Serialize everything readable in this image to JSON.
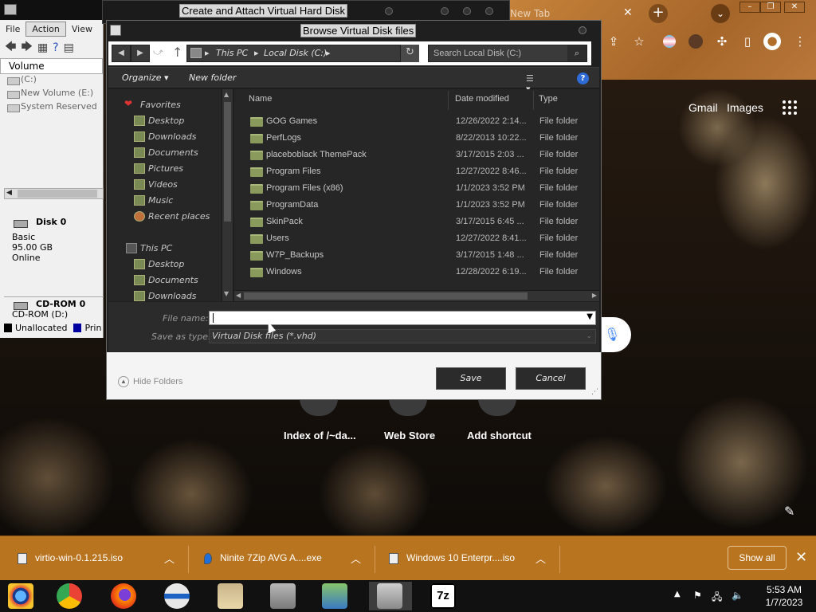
{
  "browser": {
    "tab_title": "New Tab",
    "links": {
      "gmail": "Gmail",
      "images": "Images"
    },
    "shortcuts": [
      "Index of /~da...",
      "Web Store",
      "Add shortcut"
    ]
  },
  "disk_mgmt": {
    "menu": [
      "File",
      "Action",
      "View"
    ],
    "column_header": "Volume",
    "volumes": [
      "(C:)",
      "New Volume (E:)",
      "System Reserved"
    ],
    "disk0": {
      "name": "Disk 0",
      "type": "Basic",
      "size": "95.00 GB",
      "status": "Online"
    },
    "cdrom": {
      "name": "CD-ROM 0",
      "drive": "CD-ROM (D:)"
    },
    "legend": {
      "unallocated": "Unallocated",
      "primary": "Prin"
    }
  },
  "vhd_window": {
    "title": "Create and Attach Virtual Hard Disk"
  },
  "dialog": {
    "title": "Browse Virtual Disk files",
    "breadcrumb": [
      "This PC",
      "Local Disk (C:)"
    ],
    "search_placeholder": "Search Local Disk (C:)",
    "toolbar": {
      "organize": "Organize",
      "new_folder": "New folder"
    },
    "nav": {
      "favorites": "Favorites",
      "favorite_items": [
        "Desktop",
        "Downloads",
        "Documents",
        "Pictures",
        "Videos",
        "Music",
        "Recent places"
      ],
      "this_pc": "This PC",
      "pc_items": [
        "Desktop",
        "Documents",
        "Downloads"
      ]
    },
    "columns": {
      "name": "Name",
      "date": "Date modified",
      "type": "Type"
    },
    "files": [
      {
        "name": "GOG Games",
        "date": "12/26/2022 2:14...",
        "type": "File folder"
      },
      {
        "name": "PerfLogs",
        "date": "8/22/2013 10:22...",
        "type": "File folder"
      },
      {
        "name": "placeboblack ThemePack",
        "date": "3/17/2015 2:03 ...",
        "type": "File folder"
      },
      {
        "name": "Program Files",
        "date": "12/27/2022 8:46...",
        "type": "File folder"
      },
      {
        "name": "Program Files (x86)",
        "date": "1/1/2023 3:52 PM",
        "type": "File folder"
      },
      {
        "name": "ProgramData",
        "date": "1/1/2023 3:52 PM",
        "type": "File folder"
      },
      {
        "name": "SkinPack",
        "date": "3/17/2015 6:45 ...",
        "type": "File folder"
      },
      {
        "name": "Users",
        "date": "12/27/2022 8:41...",
        "type": "File folder"
      },
      {
        "name": "W7P_Backups",
        "date": "3/17/2015 1:48 ...",
        "type": "File folder"
      },
      {
        "name": "Windows",
        "date": "12/28/2022 6:19...",
        "type": "File folder"
      }
    ],
    "file_name_label": "File name:",
    "file_name_value": "",
    "save_as_label": "Save as type:",
    "save_as_value": "Virtual Disk files (*.vhd)",
    "hide_folders": "Hide Folders",
    "save_button": "Save",
    "cancel_button": "Cancel"
  },
  "downloads": {
    "items": [
      "virtio-win-0.1.215.iso",
      "Ninite 7Zip AVG A....exe",
      "Windows 10 Enterpr....iso"
    ],
    "show_all": "Show all"
  },
  "taskbar": {
    "time": "5:53 AM",
    "date": "1/7/2023",
    "sevenzip_label": "7z"
  }
}
